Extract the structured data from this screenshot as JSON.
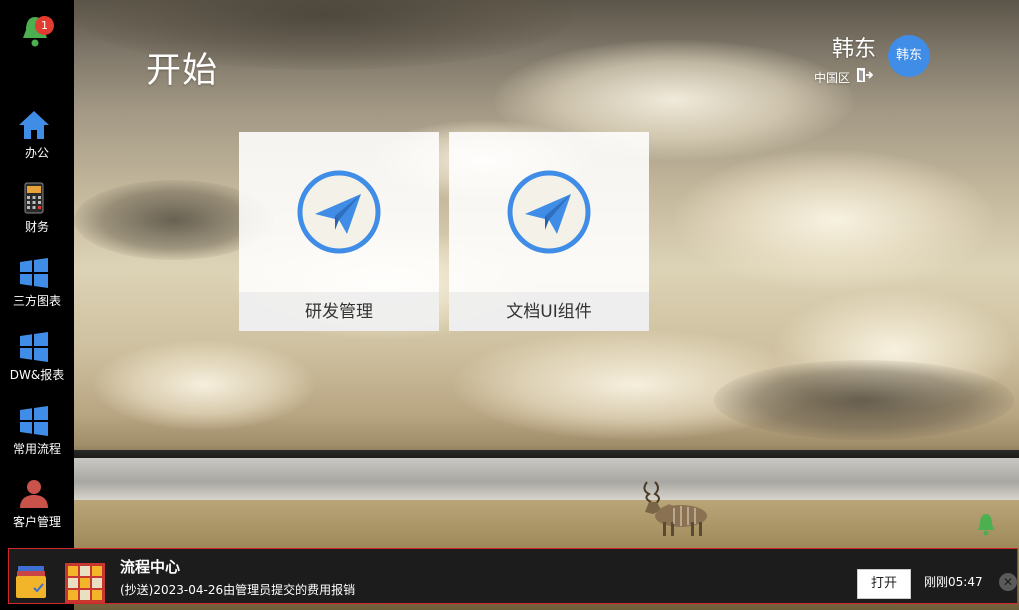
{
  "notifications": {
    "bell_count": "1"
  },
  "sidebar": {
    "items": [
      {
        "label": "办公",
        "icon": "home-icon"
      },
      {
        "label": "财务",
        "icon": "calculator-icon"
      },
      {
        "label": "三方图表",
        "icon": "windows-icon"
      },
      {
        "label": "DW&报表",
        "icon": "windows-icon"
      },
      {
        "label": "常用流程",
        "icon": "windows-icon"
      },
      {
        "label": "客户管理",
        "icon": "user-icon"
      }
    ]
  },
  "header": {
    "title": "开始",
    "user_name": "韩东",
    "region": "中国区",
    "avatar_text": "韩东"
  },
  "tiles": [
    {
      "label": "研发管理",
      "icon": "paper-plane-icon"
    },
    {
      "label": "文档UI组件",
      "icon": "paper-plane-icon"
    }
  ],
  "toast": {
    "title": "流程中心",
    "message": "(抄送)2023-04-26由管理员提交的费用报销",
    "open_label": "打开",
    "time": "刚刚05:47",
    "close_label": "✕"
  },
  "colors": {
    "sidebar_bg": "#000000",
    "icon_blue": "#3f8de6",
    "badge_red": "#e23b2f",
    "toast_border": "#d2262a",
    "bell_green": "#4caf50"
  }
}
